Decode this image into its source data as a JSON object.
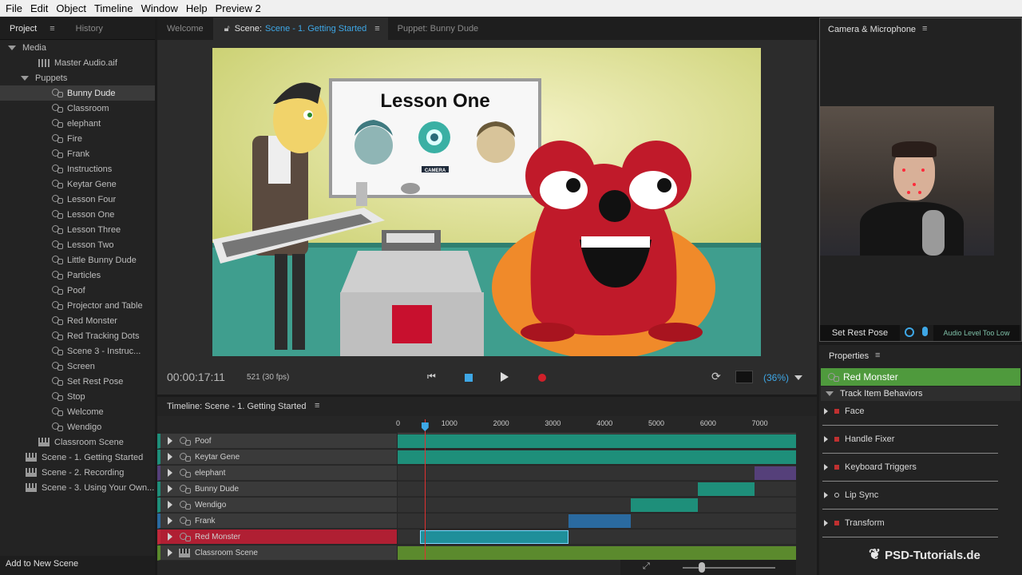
{
  "menu": [
    "File",
    "Edit",
    "Object",
    "Timeline",
    "Window",
    "Help",
    "Preview 2"
  ],
  "project": {
    "tabs": [
      "Project",
      "History"
    ],
    "tree": [
      {
        "label": "Media",
        "type": "folder",
        "indent": 0
      },
      {
        "label": "Master Audio.aif",
        "type": "audio",
        "indent": 2
      },
      {
        "label": "Puppets",
        "type": "folder",
        "indent": 1
      },
      {
        "label": "Bunny Dude",
        "type": "puppet",
        "indent": 3,
        "selected": true
      },
      {
        "label": "Classroom",
        "type": "puppet",
        "indent": 3
      },
      {
        "label": "elephant",
        "type": "puppet",
        "indent": 3
      },
      {
        "label": "Fire",
        "type": "puppet",
        "indent": 3
      },
      {
        "label": "Frank",
        "type": "puppet",
        "indent": 3
      },
      {
        "label": "Instructions",
        "type": "puppet",
        "indent": 3
      },
      {
        "label": "Keytar Gene",
        "type": "puppet",
        "indent": 3
      },
      {
        "label": "Lesson Four",
        "type": "puppet",
        "indent": 3
      },
      {
        "label": "Lesson One",
        "type": "puppet",
        "indent": 3
      },
      {
        "label": "Lesson Three",
        "type": "puppet",
        "indent": 3
      },
      {
        "label": "Lesson Two",
        "type": "puppet",
        "indent": 3
      },
      {
        "label": "Little Bunny Dude",
        "type": "puppet",
        "indent": 3
      },
      {
        "label": "Particles",
        "type": "puppet",
        "indent": 3
      },
      {
        "label": "Poof",
        "type": "puppet",
        "indent": 3
      },
      {
        "label": "Projector and Table",
        "type": "puppet",
        "indent": 3
      },
      {
        "label": "Red Monster",
        "type": "puppet",
        "indent": 3
      },
      {
        "label": "Red Tracking Dots",
        "type": "puppet",
        "indent": 3
      },
      {
        "label": "Scene 3 - Instruc...",
        "type": "puppet",
        "indent": 3
      },
      {
        "label": "Screen",
        "type": "puppet",
        "indent": 3
      },
      {
        "label": "Set Rest Pose",
        "type": "puppet",
        "indent": 3
      },
      {
        "label": "Stop",
        "type": "puppet",
        "indent": 3
      },
      {
        "label": "Welcome",
        "type": "puppet",
        "indent": 3
      },
      {
        "label": "Wendigo",
        "type": "puppet",
        "indent": 3
      },
      {
        "label": "Classroom Scene",
        "type": "scene",
        "indent": 2
      },
      {
        "label": "Scene - 1. Getting Started",
        "type": "scene",
        "indent": 1
      },
      {
        "label": "Scene - 2. Recording",
        "type": "scene",
        "indent": 1
      },
      {
        "label": "Scene - 3. Using Your Own...",
        "type": "scene",
        "indent": 1
      }
    ],
    "add_button": "Add to New Scene"
  },
  "scene": {
    "tab_welcome": "Welcome",
    "tab_scene_prefix": "Scene:",
    "tab_scene_name": "Scene - 1. Getting Started",
    "tab_puppet": "Puppet: Bunny Dude",
    "board_title": "Lesson One",
    "camera_badge": "CAMERA",
    "timecode": "00:00:17:11",
    "frame": "521 (30 fps)",
    "zoom": "(36%)"
  },
  "timeline": {
    "title": "Timeline: Scene - 1. Getting Started",
    "ruler": [
      "0",
      "1000",
      "2000",
      "3000",
      "4000",
      "5000",
      "6000",
      "7000"
    ],
    "playhead_frame": 521,
    "tracks": [
      {
        "label": "Poof",
        "color": "#1e8f7a"
      },
      {
        "label": "Keytar Gene",
        "color": "#1e8f7a"
      },
      {
        "label": "elephant",
        "color": "#55407a"
      },
      {
        "label": "Bunny Dude",
        "color": "#1e8f7a"
      },
      {
        "label": "Wendigo",
        "color": "#1e8f7a"
      },
      {
        "label": "Frank",
        "color": "#2a6aa0"
      },
      {
        "label": "Red Monster",
        "color": "#c0283a",
        "selected": true
      },
      {
        "label": "Classroom Scene",
        "color": "#5b8a2d"
      }
    ]
  },
  "camera": {
    "title": "Camera & Microphone",
    "rest_pose": "Set Rest Pose",
    "audio_status": "Audio Level Too Low"
  },
  "properties": {
    "title": "Properties",
    "puppet": "Red Monster",
    "section": "Track Item Behaviors",
    "behaviors": [
      "Face",
      "Handle Fixer",
      "Keyboard Triggers",
      "Lip Sync",
      "Transform"
    ]
  },
  "watermark": "PSD-Tutorials.de"
}
